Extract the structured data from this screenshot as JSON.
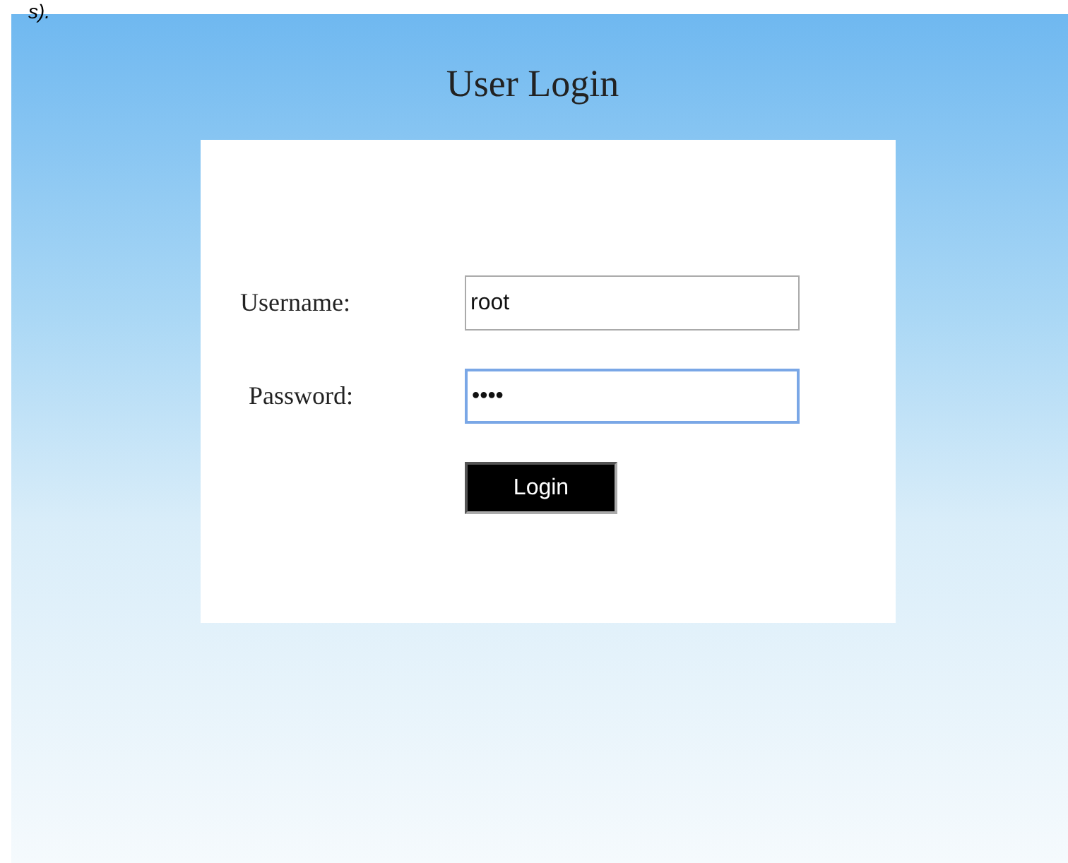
{
  "fragment": "s).",
  "title": "User Login",
  "fields": [
    {
      "label": "Username:",
      "value": "root",
      "focused": false
    },
    {
      "label": "Password:",
      "value": "••••",
      "focused": true
    }
  ],
  "button": "Login"
}
